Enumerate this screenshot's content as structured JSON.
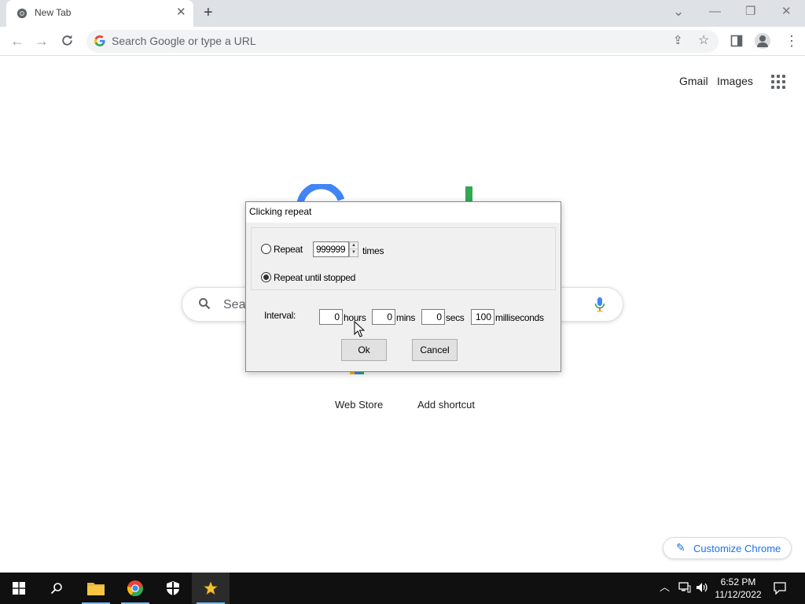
{
  "browser": {
    "tab_title": "New Tab",
    "tab_close": "✕",
    "new_tab": "+",
    "omnibox_placeholder": "Search Google or type a URL"
  },
  "window_controls": {
    "tab_search": "⌄",
    "minimize": "—",
    "restore": "❐",
    "close": "✕"
  },
  "page": {
    "gmail": "Gmail",
    "images": "Images",
    "search_placeholder": "Sear",
    "shortcuts": [
      "Web Store",
      "Add shortcut"
    ],
    "customize_label": "Customize Chrome"
  },
  "dialog": {
    "title": "Clicking repeat",
    "repeat_label": "Repeat",
    "repeat_value": "999999",
    "times_label": "times",
    "repeat_until_label": "Repeat until stopped",
    "selected_mode": "Repeat until stopped",
    "interval_label": "Interval:",
    "hours_value": "0",
    "hours_label": "hours",
    "mins_value": "0",
    "mins_label": "mins",
    "secs_value": "0",
    "secs_label": "secs",
    "ms_value": "100",
    "ms_label": "milliseconds",
    "ok_label": "Ok",
    "cancel_label": "Cancel"
  },
  "taskbar": {
    "time": "6:52 PM",
    "date": "11/12/2022",
    "icons": [
      "windows-start-icon",
      "search-icon",
      "file-explorer-icon",
      "chrome-icon",
      "windows-security-icon",
      "auto-clicker-icon"
    ]
  },
  "colors": {
    "google_blue": "#4285f4",
    "google_green": "#34a853",
    "link_blue": "#1a73e8",
    "taskbar_bg": "#101010"
  }
}
